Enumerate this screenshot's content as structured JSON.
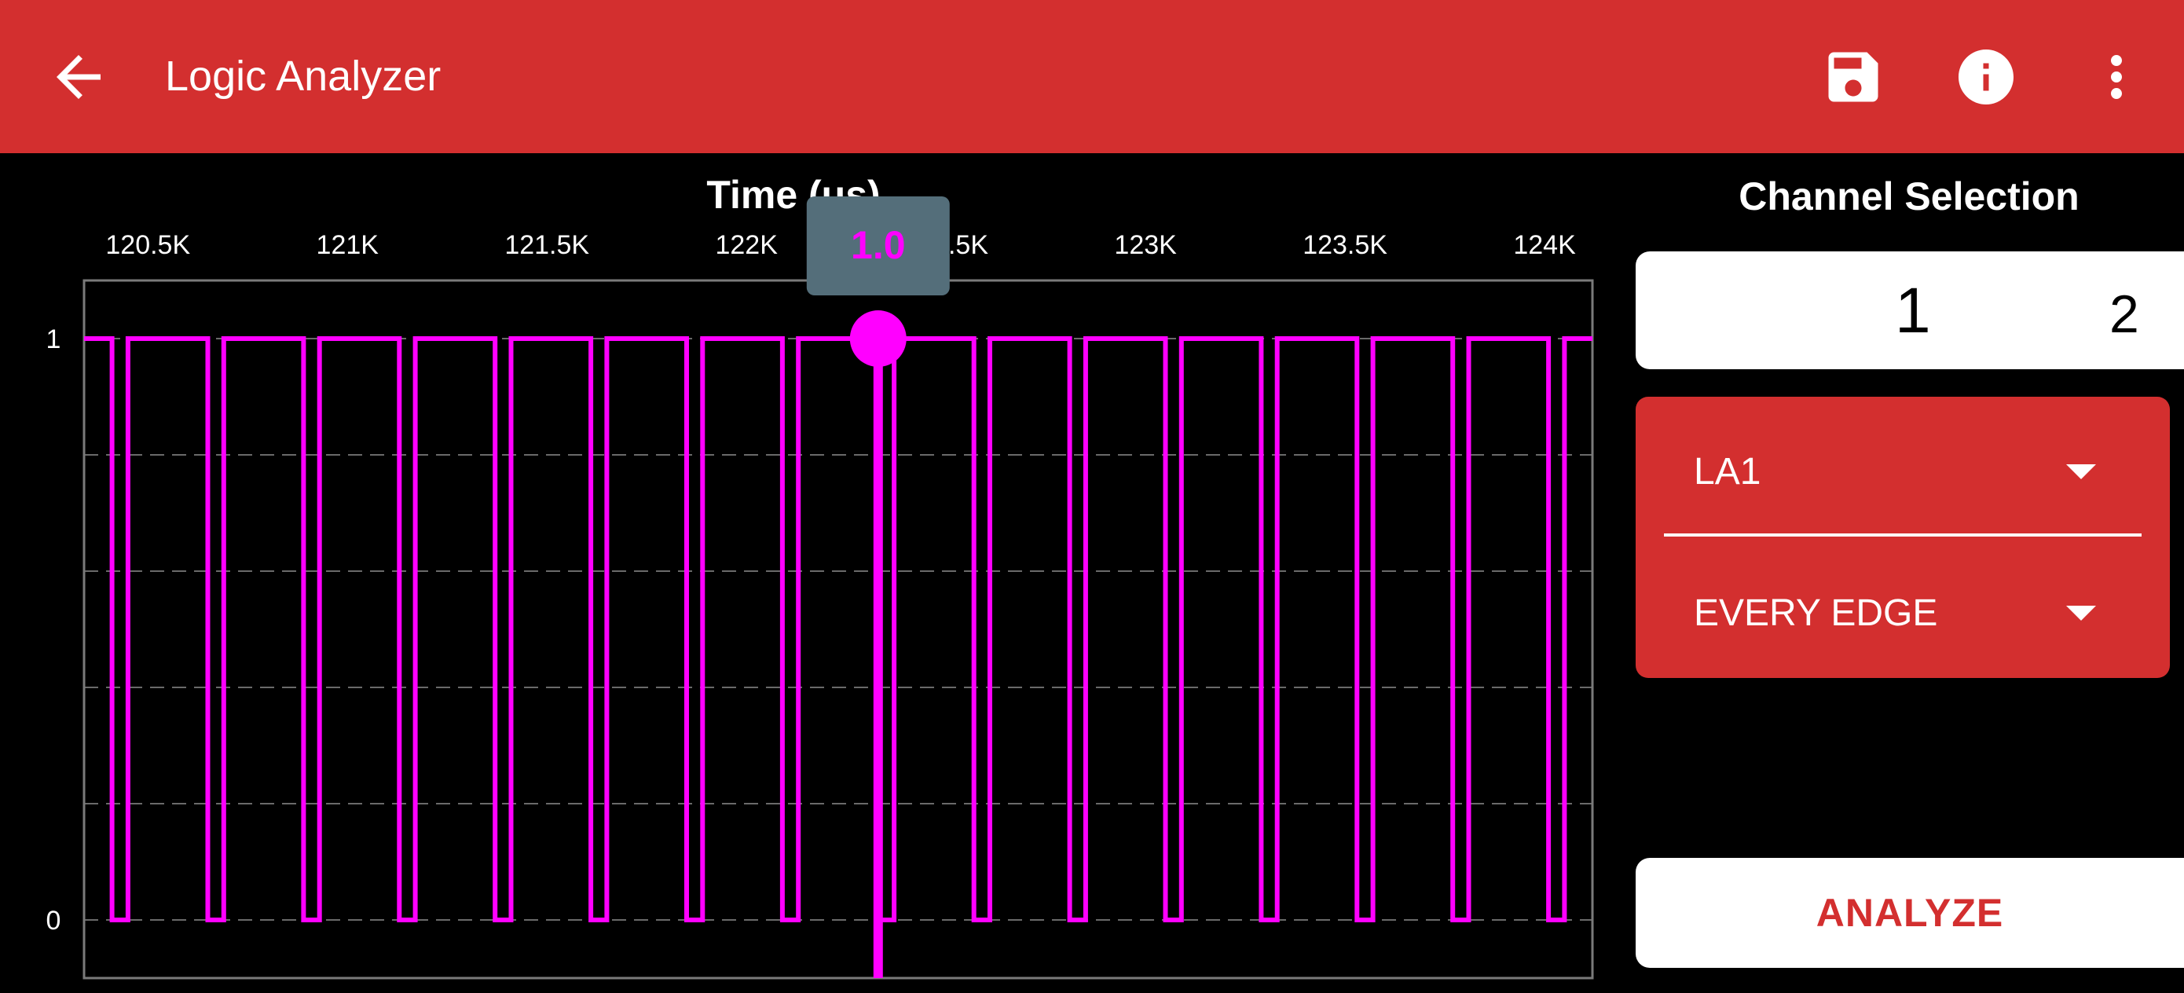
{
  "app_bar": {
    "title": "Logic Analyzer",
    "icons": [
      "back-arrow-icon",
      "save-icon",
      "info-icon",
      "more-vert-icon"
    ],
    "color": "#d32f2f"
  },
  "chart": {
    "axis_title": "Time (us)",
    "tooltip_value": "1.0"
  },
  "chart_data": {
    "type": "line",
    "title": "",
    "xlabel": "Time (us)",
    "ylabel": "",
    "xlim": [
      120340,
      124120
    ],
    "ylim": [
      -0.1,
      1.1
    ],
    "x_ticks": [
      120500,
      121000,
      121500,
      122000,
      122500,
      123000,
      123500,
      124000
    ],
    "x_tick_labels": [
      "120.5K",
      "121K",
      "121.5K",
      "122K",
      "122.5K",
      "123K",
      "123.5K",
      "124K"
    ],
    "y_ticks": [
      0,
      1
    ],
    "y_tick_labels": [
      "0",
      "1"
    ],
    "grid": "horizontal-dashed",
    "color": "#ff00ff",
    "series": [
      {
        "points": [
          [
            120340,
            1
          ],
          [
            120410,
            1
          ],
          [
            120410,
            0
          ],
          [
            120450,
            0
          ],
          [
            120450,
            1
          ],
          [
            120650,
            1
          ],
          [
            120650,
            0
          ],
          [
            120690,
            0
          ],
          [
            120690,
            1
          ],
          [
            120890,
            1
          ],
          [
            120890,
            0
          ],
          [
            120930,
            0
          ],
          [
            120930,
            1
          ],
          [
            121130,
            1
          ],
          [
            121130,
            0
          ],
          [
            121170,
            0
          ],
          [
            121170,
            1
          ],
          [
            121370,
            1
          ],
          [
            121370,
            0
          ],
          [
            121410,
            0
          ],
          [
            121410,
            1
          ],
          [
            121610,
            1
          ],
          [
            121610,
            0
          ],
          [
            121650,
            0
          ],
          [
            121650,
            1
          ],
          [
            121850,
            1
          ],
          [
            121850,
            0
          ],
          [
            121890,
            0
          ],
          [
            121890,
            1
          ],
          [
            122090,
            1
          ],
          [
            122090,
            0
          ],
          [
            122130,
            0
          ],
          [
            122130,
            1
          ],
          [
            122330,
            1
          ],
          [
            122330,
            0
          ],
          [
            122370,
            0
          ],
          [
            122370,
            1
          ],
          [
            122570,
            1
          ],
          [
            122570,
            0
          ],
          [
            122610,
            0
          ],
          [
            122610,
            1
          ],
          [
            122810,
            1
          ],
          [
            122810,
            0
          ],
          [
            122850,
            0
          ],
          [
            122850,
            1
          ],
          [
            123050,
            1
          ],
          [
            123050,
            0
          ],
          [
            123090,
            0
          ],
          [
            123090,
            1
          ],
          [
            123290,
            1
          ],
          [
            123290,
            0
          ],
          [
            123330,
            0
          ],
          [
            123330,
            1
          ],
          [
            123530,
            1
          ],
          [
            123530,
            0
          ],
          [
            123570,
            0
          ],
          [
            123570,
            1
          ],
          [
            123770,
            1
          ],
          [
            123770,
            0
          ],
          [
            123810,
            0
          ],
          [
            123810,
            1
          ],
          [
            124010,
            1
          ],
          [
            124010,
            0
          ],
          [
            124050,
            0
          ],
          [
            124050,
            1
          ],
          [
            124120,
            1
          ]
        ]
      }
    ],
    "cursor": {
      "x": 122330,
      "y": 1.0
    }
  },
  "channel_selection": {
    "title": "Channel Selection",
    "channels": [
      "1",
      "2"
    ],
    "selected_channel": "1",
    "channel_select": "LA1",
    "trigger_select": "EVERY EDGE"
  },
  "analyze_button": "ANALYZE"
}
